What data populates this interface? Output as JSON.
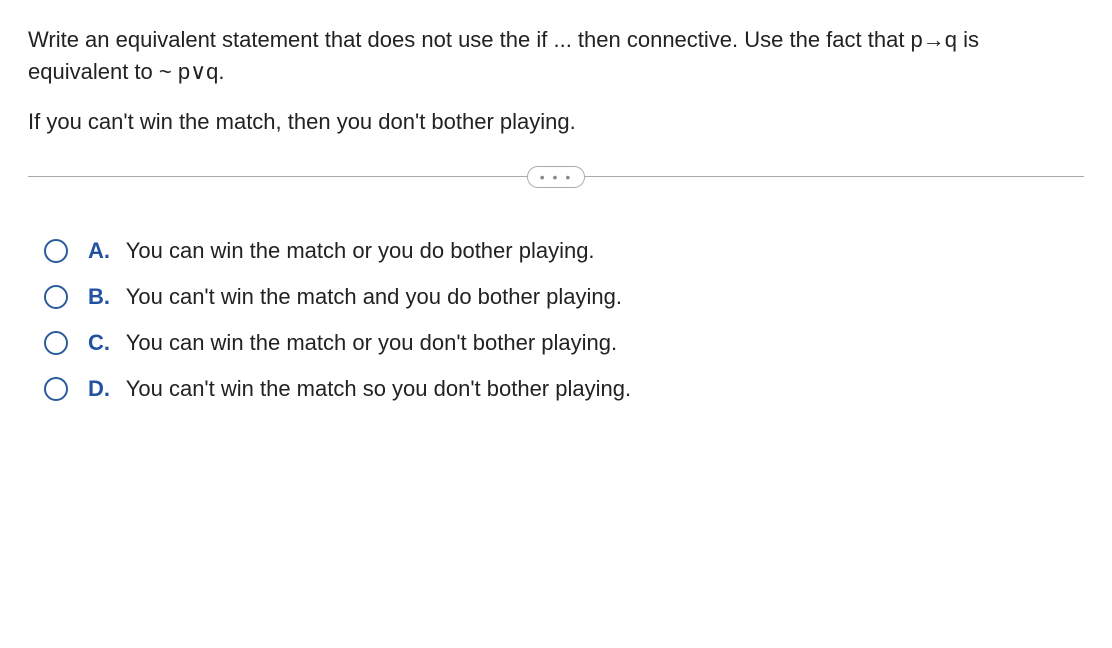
{
  "question": {
    "prompt": "Write an equivalent statement that does not use the if ... then connective. Use the fact that p→q is equivalent to  ~ p∨q.",
    "statement": "If you can't win the match, then you don't bother playing."
  },
  "divider_glyph": "• • •",
  "options": [
    {
      "letter": "A.",
      "text": "You can win the match or you do bother playing."
    },
    {
      "letter": "B.",
      "text": "You can't win the match and you do bother playing."
    },
    {
      "letter": "C.",
      "text": "You can win the match or you don't bother playing."
    },
    {
      "letter": "D.",
      "text": "You can't win the match so you don't bother playing."
    }
  ]
}
